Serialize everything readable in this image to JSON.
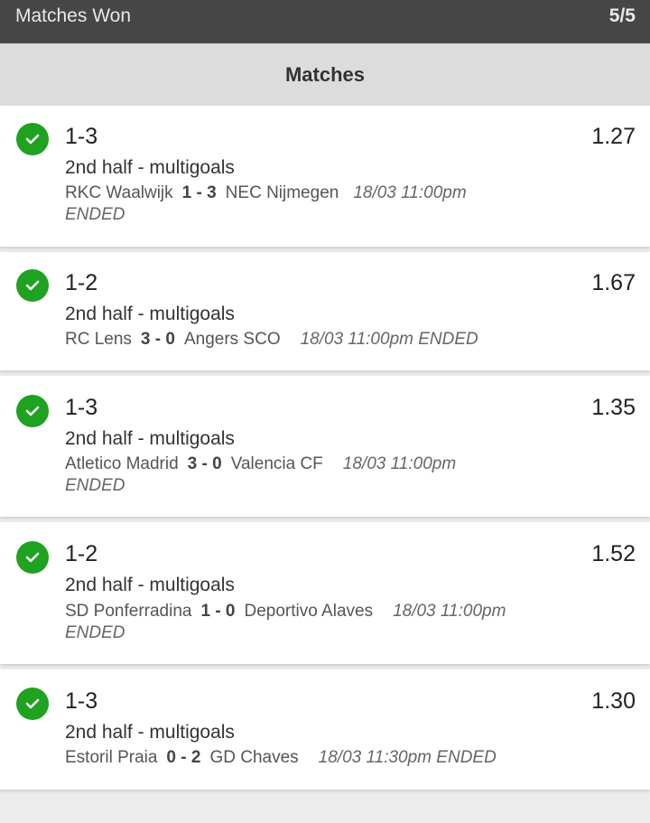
{
  "header": {
    "title": "Matches Won",
    "count": "5/5"
  },
  "section": {
    "title": "Matches"
  },
  "matches": [
    {
      "pick": "1-3",
      "odds": "1.27",
      "market": "2nd half - multigoals",
      "home": "RKC Waalwijk",
      "score": "1 - 3",
      "away": "NEC Nijmegen",
      "datetime": "18/03 11:00pm",
      "status": "ENDED"
    },
    {
      "pick": "1-2",
      "odds": "1.67",
      "market": "2nd half - multigoals",
      "home": "RC Lens",
      "score": "3 - 0",
      "away": "Angers SCO",
      "datetime": "18/03 11:00pm",
      "status": "ENDED"
    },
    {
      "pick": "1-3",
      "odds": "1.35",
      "market": "2nd half - multigoals",
      "home": "Atletico Madrid",
      "score": "3 - 0",
      "away": "Valencia CF",
      "datetime": "18/03 11:00pm",
      "status": "ENDED"
    },
    {
      "pick": "1-2",
      "odds": "1.52",
      "market": "2nd half - multigoals",
      "home": "SD Ponferradina",
      "score": "1 - 0",
      "away": "Deportivo Alaves",
      "datetime": "18/03 11:00pm",
      "status": "ENDED"
    },
    {
      "pick": "1-3",
      "odds": "1.30",
      "market": "2nd half - multigoals",
      "home": "Estoril Praia",
      "score": "0 - 2",
      "away": "GD Chaves",
      "datetime": "18/03 11:30pm",
      "status": "ENDED"
    }
  ],
  "colors": {
    "won": "#1fa21f",
    "topbar": "#464646",
    "section": "#dcdcdc"
  },
  "icons": {
    "won": "check-circle-icon"
  }
}
